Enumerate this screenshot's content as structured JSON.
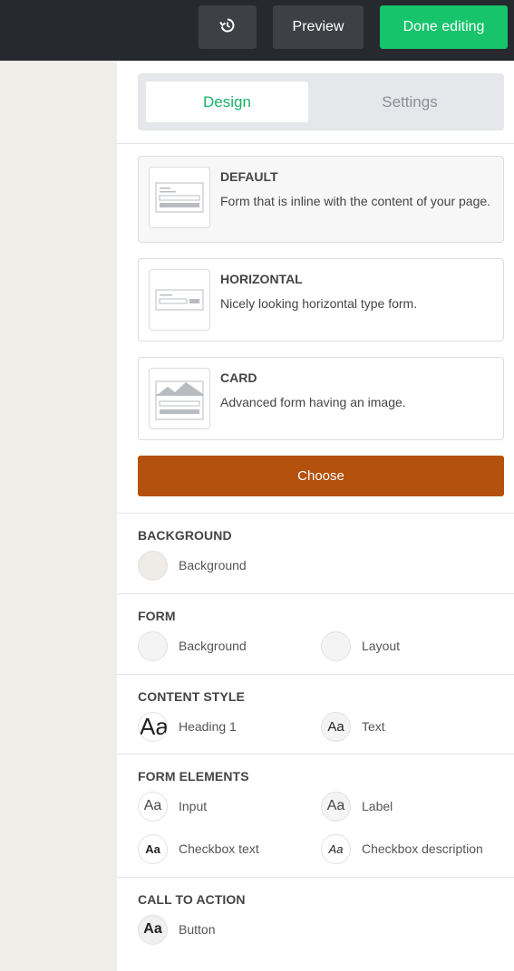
{
  "toolbar": {
    "history_icon": "history-icon",
    "preview_label": "Preview",
    "done_label": "Done editing"
  },
  "tabs": {
    "design": "Design",
    "settings": "Settings",
    "active": "Design",
    "active_color": "#17b267"
  },
  "layouts": [
    {
      "title": "DEFAULT",
      "description": "Form that is inline with the content of your page.",
      "icon": "inline-form-icon",
      "selected": true
    },
    {
      "title": "HORIZONTAL",
      "description": "Nicely looking horizontal type form.",
      "icon": "horizontal-form-icon",
      "selected": false
    },
    {
      "title": "CARD",
      "description": "Advanced form having an image.",
      "icon": "card-form-icon",
      "selected": false
    }
  ],
  "choose_button": {
    "label": "Choose",
    "color": "#b3500c"
  },
  "sections": {
    "background": {
      "title": "BACKGROUND",
      "items": [
        "Background"
      ]
    },
    "form": {
      "title": "FORM",
      "items": [
        "Background",
        "Layout"
      ]
    },
    "content_style": {
      "title": "CONTENT STYLE",
      "items": [
        "Heading 1",
        "Text"
      ]
    },
    "form_elements": {
      "title": "FORM ELEMENTS",
      "items": [
        "Input",
        "Label",
        "Checkbox text",
        "Checkbox description"
      ]
    },
    "call_to_action": {
      "title": "CALL TO ACTION",
      "items": [
        "Button"
      ]
    }
  },
  "swatch_sample": "Aa",
  "colors": {
    "topbar": "#262a2e",
    "done_button": "#17c46b",
    "canvas": "#f0ece8"
  }
}
